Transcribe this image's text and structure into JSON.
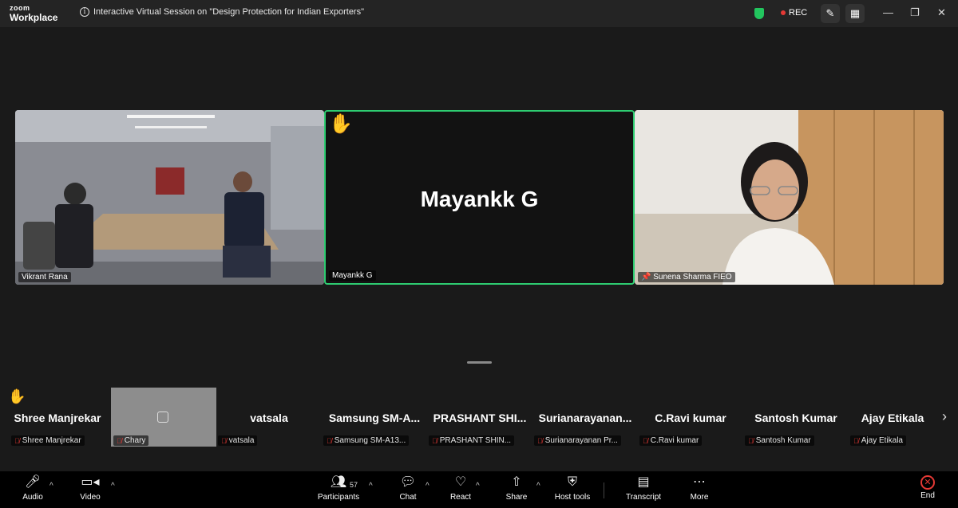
{
  "titlebar": {
    "brand_top": "zoom",
    "brand_bottom": "Workplace",
    "meeting_title": "Interactive Virtual Session on \"Design Protection for Indian Exporters\"",
    "rec_label": "REC"
  },
  "tiles": [
    {
      "label": "Vikrant Rana"
    },
    {
      "label": "Mayankk G",
      "big_name": "Mayankk G",
      "hand_raised": true
    },
    {
      "label": "Sunena Sharma FIEO",
      "pinned": true
    }
  ],
  "strip": [
    {
      "name": "Shree Manjrekar",
      "label": "Shree Manjrekar",
      "hand_raised": true
    },
    {
      "name": "",
      "label": "Chary"
    },
    {
      "name": "vatsala",
      "label": "vatsala"
    },
    {
      "name": "Samsung  SM-A...",
      "label": "Samsung SM-A13..."
    },
    {
      "name": "PRASHANT  SHI...",
      "label": "PRASHANT SHIN..."
    },
    {
      "name": "Surianarayanan...",
      "label": "Surianarayanan Pr..."
    },
    {
      "name": "C.Ravi kumar",
      "label": "C.Ravi kumar"
    },
    {
      "name": "Santosh Kumar",
      "label": "Santosh Kumar"
    },
    {
      "name": "Ajay Etikala",
      "label": "Ajay Etikala"
    }
  ],
  "toolbar": {
    "audio": "Audio",
    "video": "Video",
    "participants": "Participants",
    "participant_count": "57",
    "chat": "Chat",
    "react": "React",
    "share": "Share",
    "host_tools": "Host tools",
    "transcript": "Transcript",
    "more": "More",
    "end": "End"
  },
  "colors": {
    "active_speaker_border": "#2ecc71",
    "rec_dot": "#e53935",
    "shield": "#22c55e",
    "end": "#e53935"
  }
}
